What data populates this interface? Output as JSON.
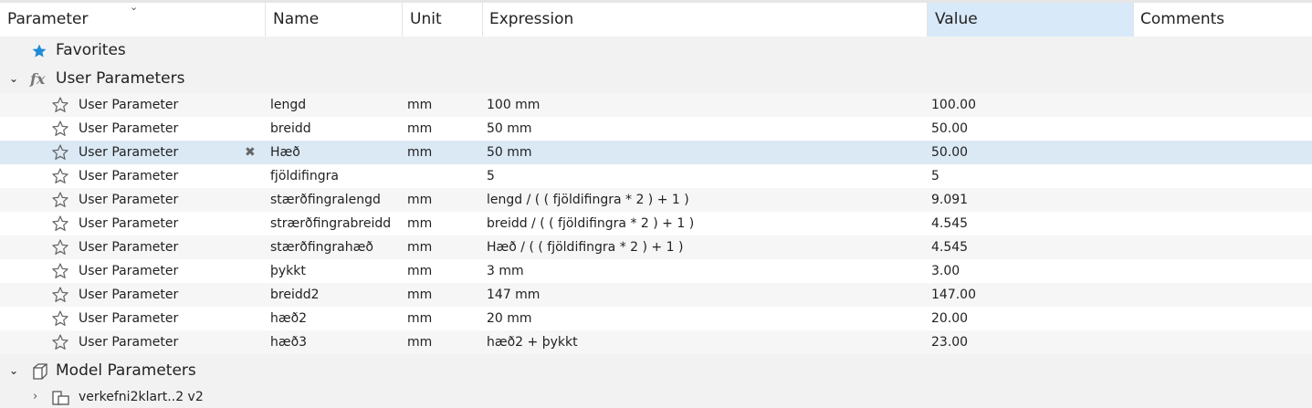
{
  "columns": {
    "parameter": "Parameter",
    "name": "Name",
    "unit": "Unit",
    "expression": "Expression",
    "value": "Value",
    "comments": "Comments"
  },
  "groups": {
    "favorites": "Favorites",
    "user": "User Parameters",
    "model": "Model Parameters"
  },
  "rows": [
    {
      "type": "User Parameter",
      "name": "lengd",
      "unit": "mm",
      "expression": "100 mm",
      "value": "100.00"
    },
    {
      "type": "User Parameter",
      "name": "breidd",
      "unit": "mm",
      "expression": "50 mm",
      "value": "50.00"
    },
    {
      "type": "User Parameter",
      "name": "Hæð",
      "unit": "mm",
      "expression": "50 mm",
      "value": "50.00"
    },
    {
      "type": "User Parameter",
      "name": "fjöldifingra",
      "unit": "",
      "expression": "5",
      "value": "5"
    },
    {
      "type": "User Parameter",
      "name": "stærðfingralengd",
      "unit": "mm",
      "expression": "lengd / ( ( fjöldifingra * 2 ) + 1 )",
      "value": "9.091"
    },
    {
      "type": "User Parameter",
      "name": "strærðfingrabreidd",
      "unit": "mm",
      "expression": "breidd / ( ( fjöldifingra * 2 ) + 1 )",
      "value": "4.545"
    },
    {
      "type": "User Parameter",
      "name": "stærðfingrahæð",
      "unit": "mm",
      "expression": "Hæð / ( ( fjöldifingra * 2 ) + 1 )",
      "value": "4.545"
    },
    {
      "type": "User Parameter",
      "name": "þykkt",
      "unit": "mm",
      "expression": "3 mm",
      "value": "3.00"
    },
    {
      "type": "User Parameter",
      "name": "breidd2",
      "unit": "mm",
      "expression": "147 mm",
      "value": "147.00"
    },
    {
      "type": "User Parameter",
      "name": "hæð2",
      "unit": "mm",
      "expression": "20 mm",
      "value": "20.00"
    },
    {
      "type": "User Parameter",
      "name": "hæð3",
      "unit": "mm",
      "expression": "hæð2 + þykkt",
      "value": "23.00"
    }
  ],
  "model_child": "verkefni2klart..2 v2",
  "selected_row_index": 2,
  "colors": {
    "accent_star": "#1f8ad8",
    "selected_row": "#dbe9f5",
    "value_header": "#d8e9f9"
  },
  "icons": {
    "favorites": "star-filled-icon",
    "user": "fx-icon",
    "model": "cube-icon",
    "row": "star-outline-icon",
    "delete": "x-icon"
  }
}
